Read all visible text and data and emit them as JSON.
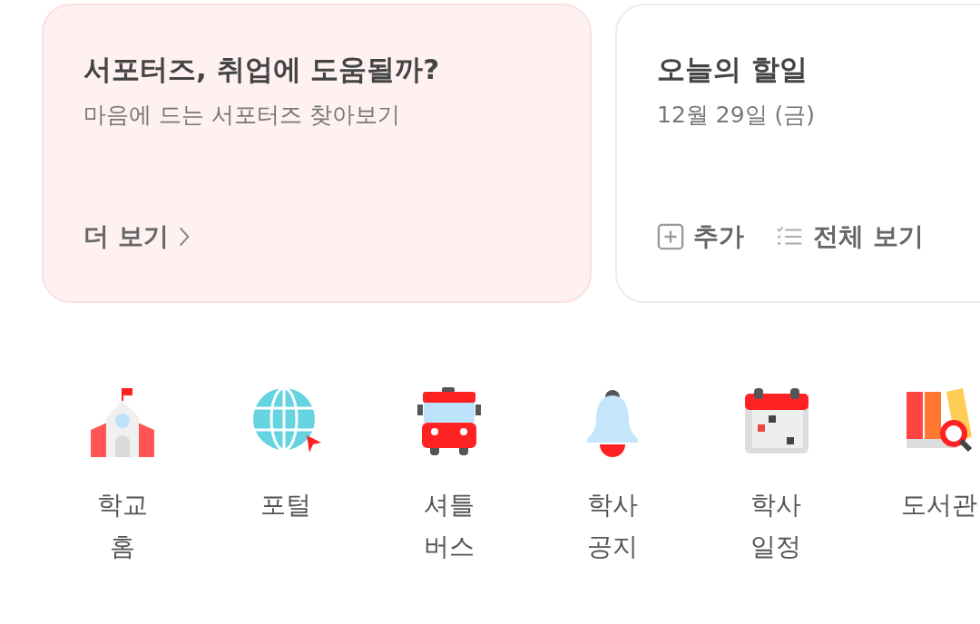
{
  "cards": [
    {
      "kind": "promo",
      "title": "서포터즈, 취업에 도움될까?",
      "subtitle": "마음에 드는 서포터즈 찾아보기",
      "actions": [
        {
          "kind": "more",
          "label": "더 보기"
        }
      ]
    },
    {
      "kind": "todo",
      "title": "오늘의 할일",
      "subtitle": "12월 29일 (금)",
      "actions": [
        {
          "kind": "add",
          "label": "추가"
        },
        {
          "kind": "list",
          "label": "전체 보기"
        }
      ]
    }
  ],
  "shortcuts": [
    {
      "kind": "school",
      "label": "학교 홈"
    },
    {
      "kind": "globe",
      "label": "포털"
    },
    {
      "kind": "bus",
      "label": "셔틀 버스"
    },
    {
      "kind": "bell",
      "label": "학사 공지"
    },
    {
      "kind": "calendar",
      "label": "학사 일정"
    },
    {
      "kind": "library",
      "label": "도서관"
    }
  ]
}
